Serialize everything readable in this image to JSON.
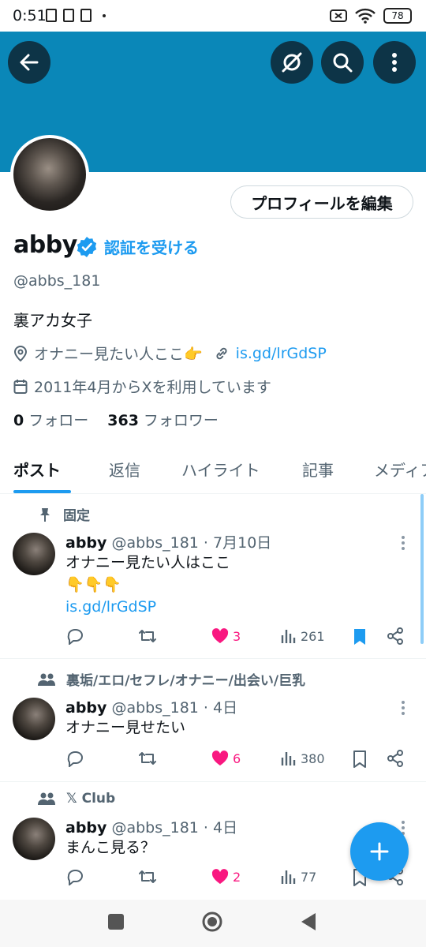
{
  "status_bar": {
    "time": "0:51",
    "battery": "78"
  },
  "profile": {
    "name": "abby",
    "get_verified": "認証を受ける",
    "handle": "@abbs_181",
    "bio": "裏アカ女子",
    "location": "オナニー見たい人ここ👉",
    "link": "is.gd/lrGdSP",
    "joined": "2011年4月からXを利用しています",
    "following_count": "0",
    "following_label": "フォロー",
    "followers_count": "363",
    "followers_label": "フォロワー",
    "edit_button": "プロフィールを編集"
  },
  "tabs": [
    {
      "label": "ポスト",
      "active": true
    },
    {
      "label": "返信"
    },
    {
      "label": "ハイライト"
    },
    {
      "label": "記事"
    },
    {
      "label": "メディア"
    }
  ],
  "posts": [
    {
      "context": "固定",
      "context_icon": "pin-icon",
      "name": "abby",
      "handle_time": "@abbs_181 · 7月10日",
      "lines": [
        "オナニー見たい人はここ",
        "👇👇👇"
      ],
      "link": "is.gd/lrGdSP",
      "likes": "3",
      "views": "261",
      "bookmarked": true
    },
    {
      "context": "裏垢/エロ/セフレ/オナニー/出会い/巨乳",
      "context_icon": "community-icon",
      "name": "abby",
      "handle_time": "@abbs_181 · 4日",
      "lines": [
        "オナニー見せたい"
      ],
      "likes": "6",
      "views": "380",
      "bookmarked": false
    },
    {
      "context": "𝕏 Club",
      "context_icon": "community-icon",
      "name": "abby",
      "handle_time": "@abbs_181 · 4日",
      "lines": [
        "まんこ見る？"
      ],
      "likes": "2",
      "views": "77",
      "bookmarked": false
    }
  ],
  "colors": {
    "banner": "#0a87b8",
    "accent": "#1d9bf0",
    "like": "#f91880"
  }
}
